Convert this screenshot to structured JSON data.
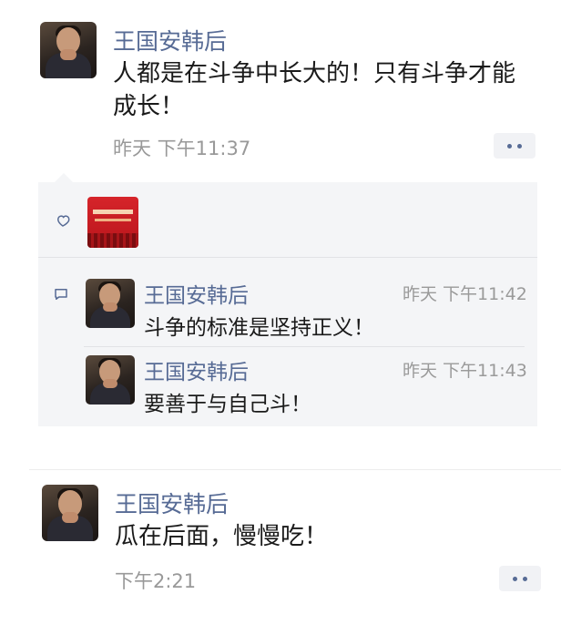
{
  "post1": {
    "author": "王国安韩后",
    "text_line1": "人都是在斗争中长大的！只有斗争才能",
    "text_line2": "成长！",
    "time": "昨天 下午11:37"
  },
  "comments": [
    {
      "author": "王国安韩后",
      "time": "昨天 下午11:42",
      "text": "斗争的标准是坚持正义！"
    },
    {
      "author": "王国安韩后",
      "time": "昨天 下午11:43",
      "text": "要善于与自己斗！"
    }
  ],
  "post2": {
    "author": "王国安韩后",
    "text": "瓜在后面，慢慢吃！",
    "time": "下午2:21"
  },
  "icons": {
    "like": "heart-outline-icon",
    "comment": "comment-bubble-icon",
    "more": "more-dots-icon"
  },
  "colors": {
    "name": "#576b95",
    "time": "#999999",
    "panel": "#f4f5f7"
  }
}
